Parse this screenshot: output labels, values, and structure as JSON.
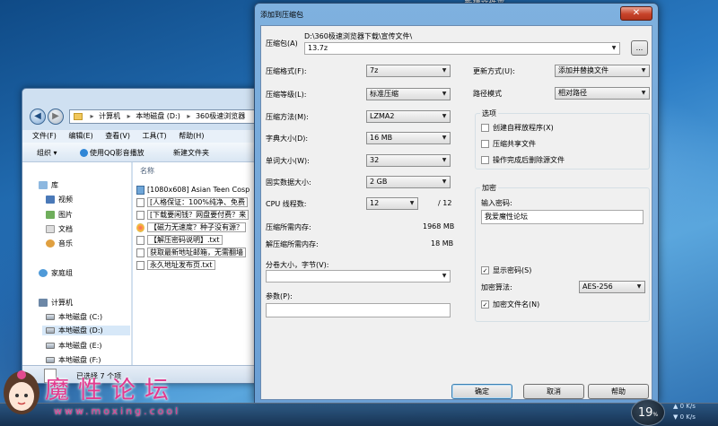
{
  "background_window_title": "新建文件夹",
  "explorer": {
    "breadcrumb": [
      "计算机",
      "本地磁盘 (D:)",
      "360极速浏览器"
    ],
    "menu": [
      "文件(F)",
      "编辑(E)",
      "查看(V)",
      "工具(T)",
      "帮助(H)"
    ],
    "toolbar": {
      "organize": "组织 ▾",
      "qq_player": "使用QQ影音播放",
      "new_folder": "新建文件夹"
    },
    "nav": {
      "library": "库",
      "videos": "视频",
      "pictures": "图片",
      "documents": "文档",
      "music": "音乐",
      "homegroup": "家庭组",
      "computer": "计算机",
      "drive_c": "本地磁盘 (C:)",
      "drive_d": "本地磁盘 (D:)",
      "drive_e": "本地磁盘 (E:)",
      "drive_f": "本地磁盘 (F:)"
    },
    "column_name": "名称",
    "files": [
      "[1080x608] Asian Teen Cosp",
      "[人格保证：100%纯净、免费",
      "[下载要闲钱？网盘要付费？来",
      "【磁力无速度？种子没有源？",
      "【解压密码说明】.txt",
      "获取最新地址邮箱，无需翻墙",
      "永久地址发布页.txt"
    ],
    "status": "已选择 7 个项"
  },
  "dialog": {
    "title": "添加到压缩包",
    "close_label": "✕",
    "archive_label": "压缩包(A)",
    "archive_path": "D:\\360极速浏览器下载\\宣传文件\\",
    "archive_name": "13.7z",
    "browse_label": "...",
    "format_label": "压缩格式(F):",
    "format_value": "7z",
    "level_label": "压缩等级(L):",
    "level_value": "标准压缩",
    "method_label": "压缩方法(M):",
    "method_value": "LZMA2",
    "dict_label": "字典大小(D):",
    "dict_value": "16 MB",
    "word_label": "单词大小(W):",
    "word_value": "32",
    "solid_label": "固实数据大小:",
    "solid_value": "2 GB",
    "threads_label": "CPU 线程数:",
    "threads_value": "12",
    "threads_total": "/ 12",
    "mem_compress_label": "压缩所需内存:",
    "mem_compress_value": "1968 MB",
    "mem_decompress_label": "解压缩所需内存:",
    "mem_decompress_value": "18 MB",
    "split_label": "分卷大小，字节(V):",
    "split_value": "",
    "params_label": "参数(P):",
    "params_value": "",
    "update_label": "更新方式(U):",
    "update_value": "添加并替换文件",
    "pathmode_label": "路径模式",
    "pathmode_value": "相对路径",
    "options_title": "选项",
    "opt_sfx": "创建自释放程序(X)",
    "opt_shared": "压缩共享文件",
    "opt_delete": "操作完成后删除源文件",
    "encrypt_title": "加密",
    "password_label": "输入密码:",
    "password_value": "我爱魔性论坛",
    "show_password": "显示密码(S)",
    "enc_method_label": "加密算法:",
    "enc_method_value": "AES-256",
    "enc_filenames": "加密文件名(N)",
    "ok_label": "确定",
    "cancel_label": "取消",
    "help_label": "帮助"
  },
  "watermark": {
    "text": "魔性论坛",
    "url": "www.moxing.cool"
  },
  "network": {
    "percent": "19",
    "percent_sign": "%",
    "up": "0 K/s",
    "down": "0 K/s"
  }
}
